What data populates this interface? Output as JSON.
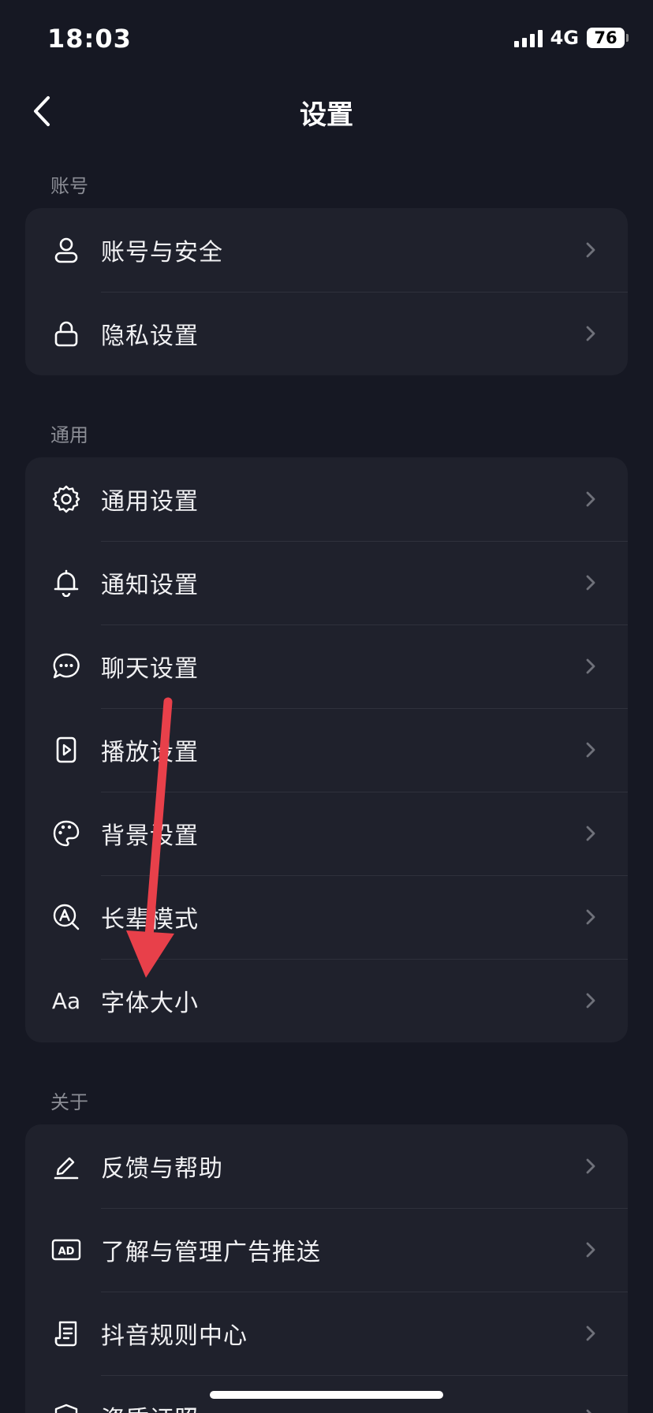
{
  "status": {
    "time": "18:03",
    "network": "4G",
    "battery": "76"
  },
  "nav": {
    "title": "设置"
  },
  "sections": [
    {
      "label": "账号",
      "items": [
        {
          "label": "账号与安全",
          "icon": "user-icon"
        },
        {
          "label": "隐私设置",
          "icon": "lock-icon"
        }
      ]
    },
    {
      "label": "通用",
      "items": [
        {
          "label": "通用设置",
          "icon": "gear-icon"
        },
        {
          "label": "通知设置",
          "icon": "bell-icon"
        },
        {
          "label": "聊天设置",
          "icon": "chat-icon"
        },
        {
          "label": "播放设置",
          "icon": "play-icon"
        },
        {
          "label": "背景设置",
          "icon": "palette-icon"
        },
        {
          "label": "长辈模式",
          "icon": "elder-mode-icon"
        },
        {
          "label": "字体大小",
          "icon": "font-size-icon",
          "icon_text": "Aa"
        }
      ]
    },
    {
      "label": "关于",
      "items": [
        {
          "label": "反馈与帮助",
          "icon": "edit-icon"
        },
        {
          "label": "了解与管理广告推送",
          "icon": "ad-icon",
          "icon_text": "AD"
        },
        {
          "label": "抖音规则中心",
          "icon": "document-icon"
        },
        {
          "label": "资质证照",
          "icon": "shield-icon"
        }
      ]
    }
  ],
  "annotation": {
    "color": "#e8404a",
    "icon": "red-arrow-annotation"
  }
}
